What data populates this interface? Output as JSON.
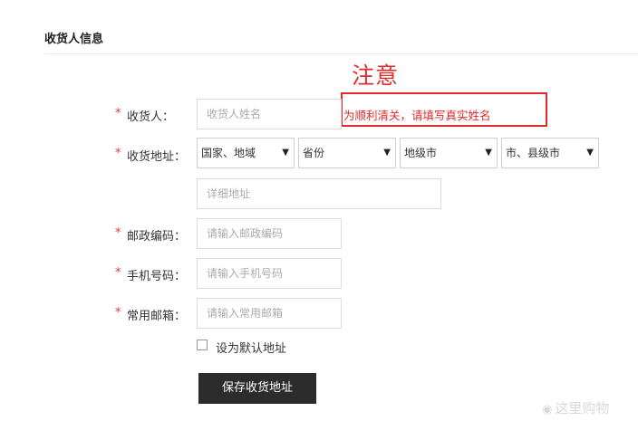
{
  "section": {
    "title": "收货人信息"
  },
  "annotation": {
    "title": "注意",
    "note": "为顺利清关，请填写真实姓名"
  },
  "form": {
    "required_mark": "*",
    "consignee": {
      "label": "收货人：",
      "placeholder": "收货人姓名"
    },
    "address": {
      "label": "收货地址：",
      "country": "国家、地域",
      "province": "省份",
      "city": "地级市",
      "county": "市、县级市",
      "arrow": "▼",
      "detail_placeholder": "详细地址"
    },
    "postal": {
      "label": "邮政编码：",
      "placeholder": "请输入邮政编码"
    },
    "phone": {
      "label": "手机号码：",
      "placeholder": "请输入手机号码"
    },
    "email": {
      "label": "常用邮箱：",
      "placeholder": "请输入常用邮箱"
    },
    "default_address": {
      "label": "设为默认地址",
      "checked": false
    },
    "save_button": "保存收货地址"
  },
  "watermark": {
    "text": "这里购物",
    "icon": "weibo-icon"
  },
  "colors": {
    "required": "#e4393c",
    "annotation": "#e02a2a",
    "button_bg": "#2c2c2c"
  }
}
